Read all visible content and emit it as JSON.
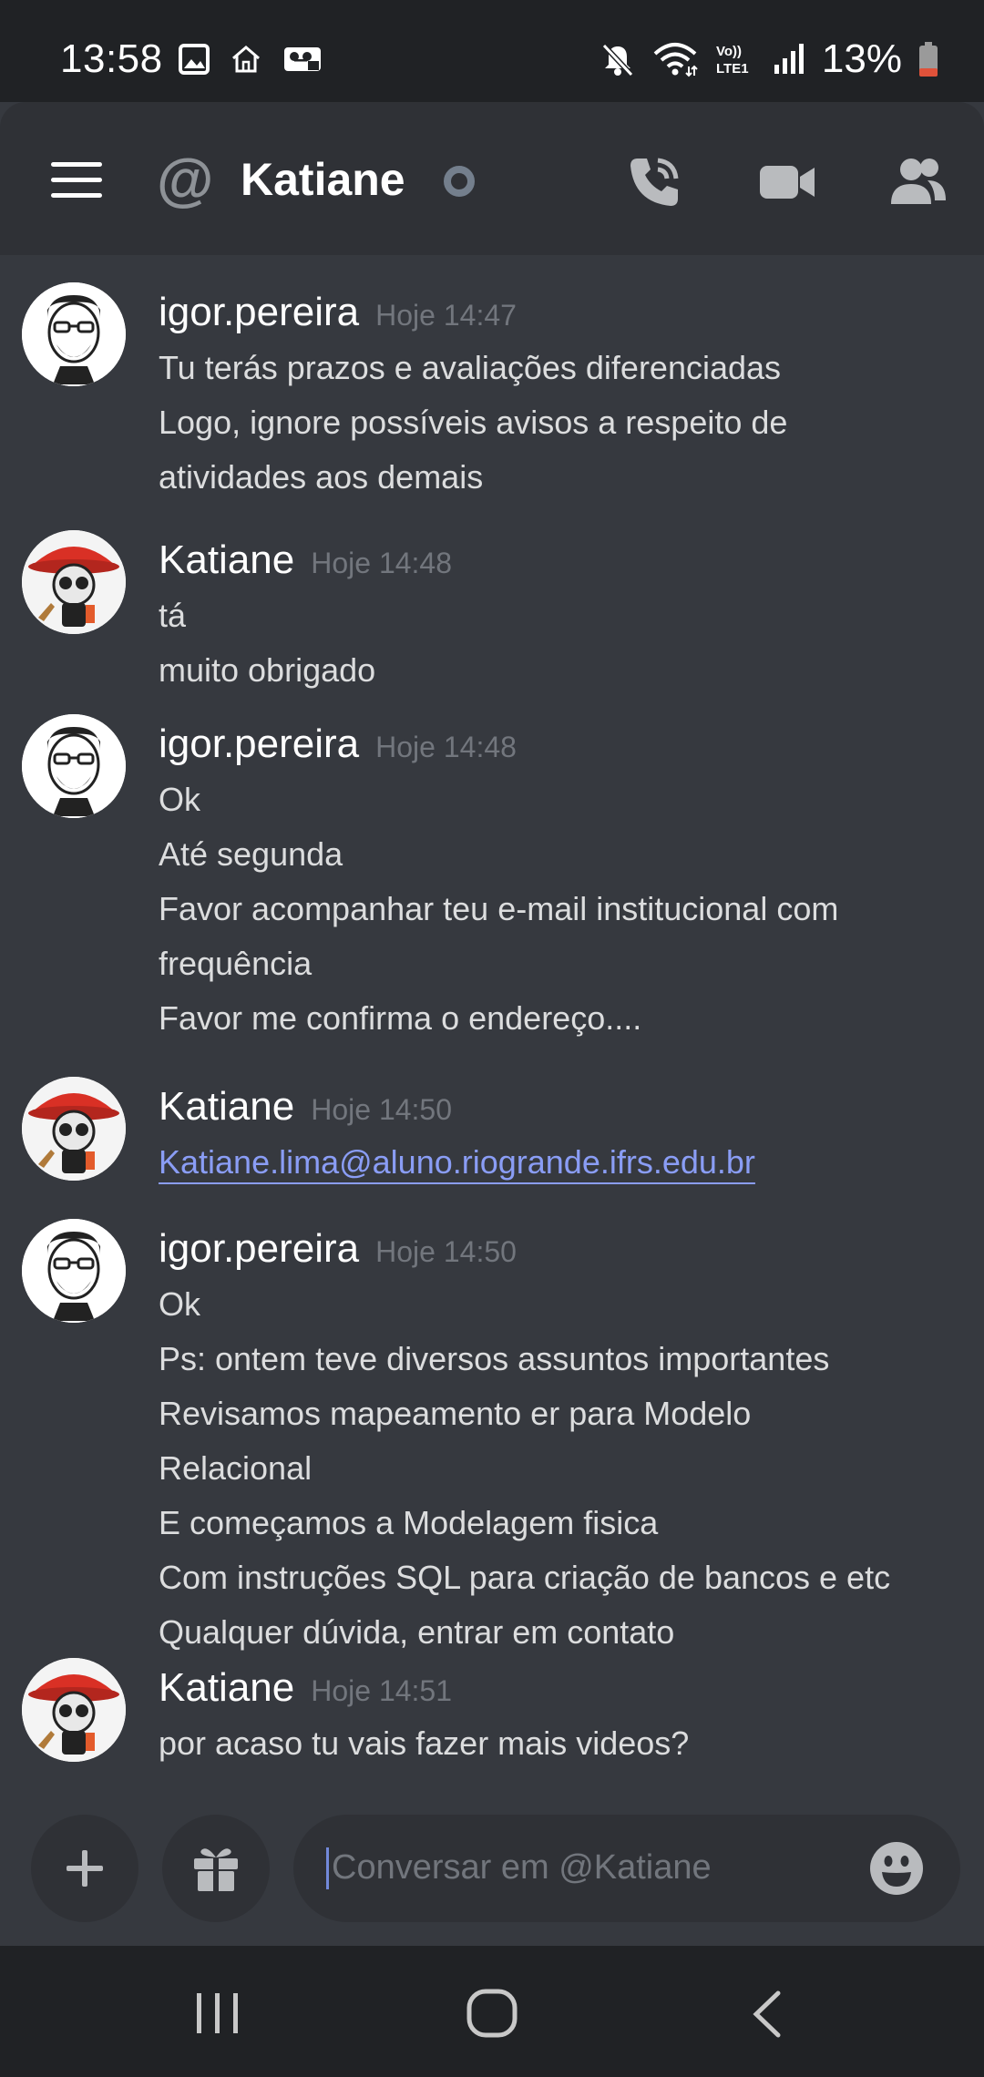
{
  "status_bar": {
    "time": "13:58",
    "battery_percent": "13%",
    "battery_level": 0.13,
    "left_icons": [
      "image-icon",
      "home-icon",
      "voicemail-icon"
    ],
    "right_icons": [
      "mute-icon",
      "wifi-icon",
      "volte-icon",
      "signal-icon",
      "battery-icon"
    ],
    "volte_label": "Vo)) LTE1"
  },
  "header": {
    "at_symbol": "@",
    "title": "Katiane",
    "status": "offline"
  },
  "messages": [
    {
      "author": "igor.pereira",
      "time": "Hoje 14:47",
      "lines": [
        "Tu terás prazos e avaliações diferenciadas",
        "Logo, ignore possíveis avisos a respeito de",
        "atividades aos demais"
      ]
    },
    {
      "author": "Katiane",
      "time": "Hoje 14:48",
      "lines": [
        "tá",
        "muito obrigado"
      ]
    },
    {
      "author": "igor.pereira",
      "time": "Hoje 14:48",
      "lines": [
        "Ok",
        "Até segunda",
        "Favor acompanhar teu e-mail institucional com",
        "frequência",
        "Favor me confirma o endereço...."
      ]
    },
    {
      "author": "Katiane",
      "time": "Hoje 14:50",
      "lines": [
        "Katiane.lima@aluno.riogrande.ifrs.edu.br"
      ]
    },
    {
      "author": "igor.pereira",
      "time": "Hoje 14:50",
      "lines": [
        "Ok",
        "Ps: ontem teve diversos assuntos importantes",
        "Revisamos mapeamento er para Modelo",
        "Relacional",
        "E começamos a Modelagem fisica",
        "Com instruções SQL para criação de bancos e etc",
        "Qualquer dúvida, entrar em contato"
      ]
    },
    {
      "author": "Katiane",
      "time": "Hoje 14:51",
      "lines": [
        "por acaso tu vais fazer mais videos?"
      ]
    }
  ],
  "composer": {
    "placeholder": "Conversar em @Katiane"
  },
  "colors": {
    "background": "#36393f",
    "header": "#2f3136",
    "statusbar": "#202225",
    "link": "#8a9df5",
    "muted": "#72767d"
  }
}
